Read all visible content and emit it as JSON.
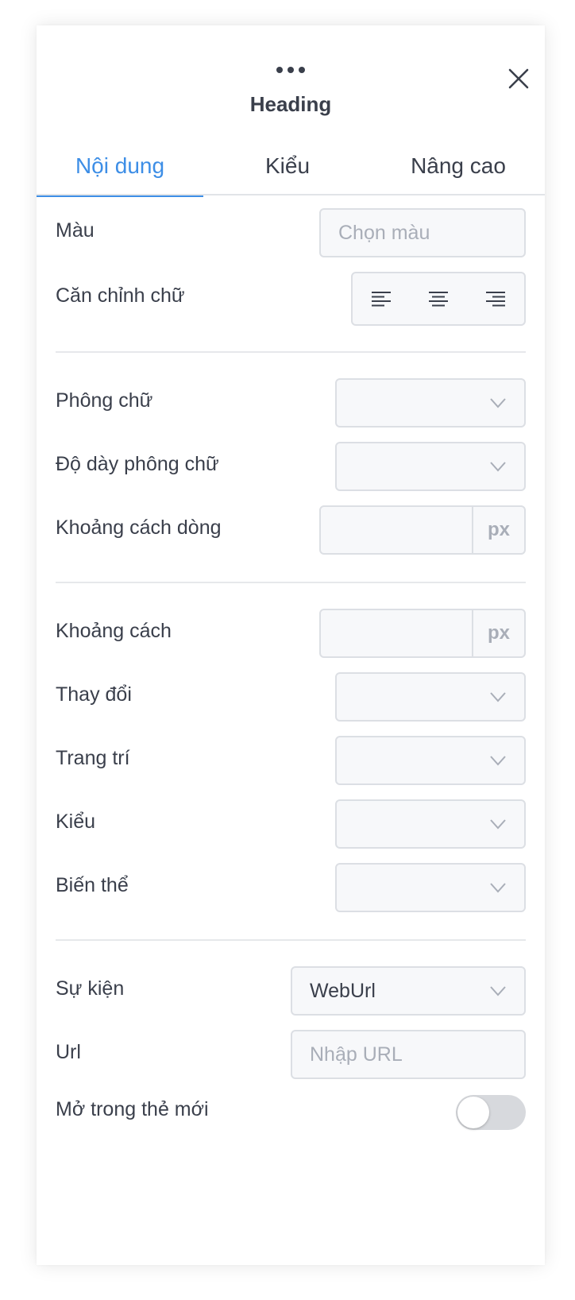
{
  "panel": {
    "title": "Heading"
  },
  "tabs": [
    {
      "label": "Nội dung",
      "active": true
    },
    {
      "label": "Kiểu",
      "active": false
    },
    {
      "label": "Nâng cao",
      "active": false
    }
  ],
  "color": {
    "label": "Màu",
    "placeholder": "Chọn màu"
  },
  "text_align": {
    "label": "Căn chỉnh chữ",
    "options": [
      "left",
      "center",
      "right"
    ]
  },
  "font_family": {
    "label": "Phông chữ",
    "value": ""
  },
  "font_weight": {
    "label": "Độ dày phông chữ",
    "value": ""
  },
  "line_height": {
    "label": "Khoảng cách dòng",
    "value": "",
    "unit": "px"
  },
  "letter_spacing": {
    "label": "Khoảng cách",
    "value": "",
    "unit": "px"
  },
  "text_transform": {
    "label": "Thay đổi",
    "value": ""
  },
  "text_decoration": {
    "label": "Trang trí",
    "value": ""
  },
  "font_style": {
    "label": "Kiểu",
    "value": ""
  },
  "font_variant": {
    "label": "Biến thể",
    "value": ""
  },
  "event": {
    "label": "Sự kiện",
    "value": "WebUrl"
  },
  "url": {
    "label": "Url",
    "placeholder": "Nhập URL"
  },
  "open_new_tab": {
    "label": "Mở trong thẻ mới",
    "checked": false
  },
  "colors": {
    "accent": "#3d8ee6",
    "text": "#3a3f4b",
    "placeholder": "#a9aeb8",
    "border": "#dcdfe4",
    "field_bg": "#f7f8fa"
  }
}
